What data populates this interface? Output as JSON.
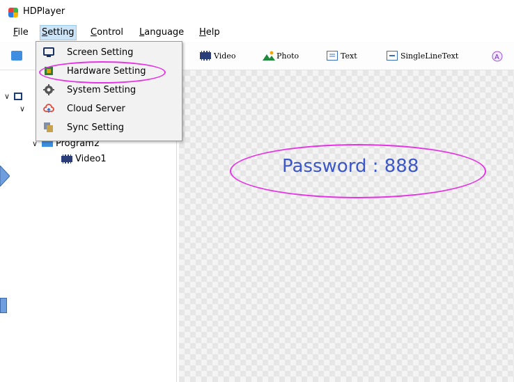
{
  "app": {
    "title": "HDPlayer"
  },
  "menubar": [
    {
      "id": "file",
      "label": "File",
      "ul": "F",
      "rest": "ile"
    },
    {
      "id": "setting",
      "label": "Setting",
      "ul": "S",
      "rest": "etting"
    },
    {
      "id": "control",
      "label": "Control",
      "ul": "C",
      "rest": "ontrol"
    },
    {
      "id": "language",
      "label": "Language",
      "ul": "L",
      "rest": "anguage"
    },
    {
      "id": "help",
      "label": "Help",
      "ul": "H",
      "rest": "elp"
    }
  ],
  "toolbar": {
    "video": "Video",
    "photo": "Photo",
    "text": "Text",
    "single_line_text": "SingleLineText"
  },
  "dropdown": {
    "items": [
      {
        "label": "Screen Setting",
        "icon": "monitor-icon"
      },
      {
        "label": "Hardware Setting",
        "icon": "chip-icon"
      },
      {
        "label": "System Setting",
        "icon": "gear-icon"
      },
      {
        "label": "Cloud Server",
        "icon": "cloud-icon"
      },
      {
        "label": "Sync Setting",
        "icon": "sync-icon"
      }
    ]
  },
  "tree": {
    "program2": "Program2",
    "video1": "Video1"
  },
  "canvas": {
    "password_text": "Password : 888"
  },
  "colors": {
    "highlight": "#e633e6",
    "password": "#3b57c9",
    "menu_selected": "#cce4f7"
  }
}
